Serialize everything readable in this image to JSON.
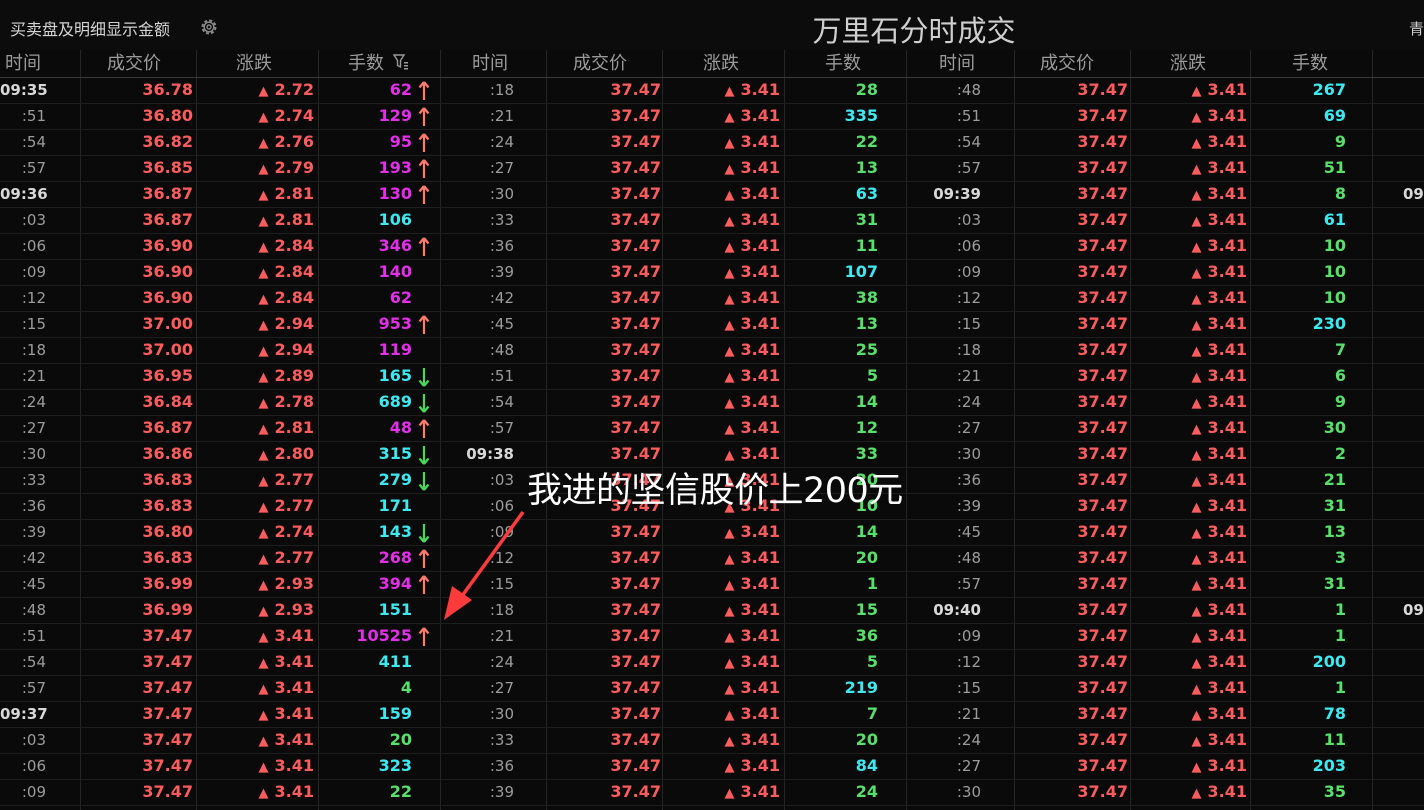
{
  "toolbar": {
    "option_label": "买卖盘及明细显示金额",
    "title": "万里石分时成交",
    "edge_char": "青"
  },
  "headers": [
    "时间",
    "成交价",
    "涨跌",
    "手数"
  ],
  "colors": {
    "up": "#ff5d5d",
    "big_buy": "#e22fe8",
    "neutral": "#3ee8f0",
    "small": "#59e06b",
    "up_arrow": "#ff7b6a",
    "down_arrow": "#47d95a"
  },
  "columns": [
    {
      "rows": [
        {
          "time": "09:35",
          "full": true,
          "price": "36.78",
          "chg": "2.72",
          "vol": "62",
          "vc": "big_buy",
          "arrow": "up"
        },
        {
          "time": ":51",
          "price": "36.80",
          "chg": "2.74",
          "vol": "129",
          "vc": "big_buy",
          "arrow": "up"
        },
        {
          "time": ":54",
          "price": "36.82",
          "chg": "2.76",
          "vol": "95",
          "vc": "big_buy",
          "arrow": "up"
        },
        {
          "time": ":57",
          "price": "36.85",
          "chg": "2.79",
          "vol": "193",
          "vc": "big_buy",
          "arrow": "up"
        },
        {
          "time": "09:36",
          "full": true,
          "price": "36.87",
          "chg": "2.81",
          "vol": "130",
          "vc": "big_buy",
          "arrow": "up"
        },
        {
          "time": ":03",
          "price": "36.87",
          "chg": "2.81",
          "vol": "106",
          "vc": "neutral",
          "arrow": ""
        },
        {
          "time": ":06",
          "price": "36.90",
          "chg": "2.84",
          "vol": "346",
          "vc": "big_buy",
          "arrow": "up"
        },
        {
          "time": ":09",
          "price": "36.90",
          "chg": "2.84",
          "vol": "140",
          "vc": "big_buy",
          "arrow": ""
        },
        {
          "time": ":12",
          "price": "36.90",
          "chg": "2.84",
          "vol": "62",
          "vc": "big_buy",
          "arrow": ""
        },
        {
          "time": ":15",
          "price": "37.00",
          "chg": "2.94",
          "vol": "953",
          "vc": "big_buy",
          "arrow": "up"
        },
        {
          "time": ":18",
          "price": "37.00",
          "chg": "2.94",
          "vol": "119",
          "vc": "big_buy",
          "arrow": ""
        },
        {
          "time": ":21",
          "price": "36.95",
          "chg": "2.89",
          "vol": "165",
          "vc": "neutral",
          "arrow": "down"
        },
        {
          "time": ":24",
          "price": "36.84",
          "chg": "2.78",
          "vol": "689",
          "vc": "neutral",
          "arrow": "down"
        },
        {
          "time": ":27",
          "price": "36.87",
          "chg": "2.81",
          "vol": "48",
          "vc": "big_buy",
          "arrow": "up"
        },
        {
          "time": ":30",
          "price": "36.86",
          "chg": "2.80",
          "vol": "315",
          "vc": "neutral",
          "arrow": "down"
        },
        {
          "time": ":33",
          "price": "36.83",
          "chg": "2.77",
          "vol": "279",
          "vc": "neutral",
          "arrow": "down"
        },
        {
          "time": ":36",
          "price": "36.83",
          "chg": "2.77",
          "vol": "171",
          "vc": "neutral",
          "arrow": ""
        },
        {
          "time": ":39",
          "price": "36.80",
          "chg": "2.74",
          "vol": "143",
          "vc": "neutral",
          "arrow": "down"
        },
        {
          "time": ":42",
          "price": "36.83",
          "chg": "2.77",
          "vol": "268",
          "vc": "big_buy",
          "arrow": "up"
        },
        {
          "time": ":45",
          "price": "36.99",
          "chg": "2.93",
          "vol": "394",
          "vc": "big_buy",
          "arrow": "up"
        },
        {
          "time": ":48",
          "price": "36.99",
          "chg": "2.93",
          "vol": "151",
          "vc": "neutral",
          "arrow": ""
        },
        {
          "time": ":51",
          "price": "37.47",
          "chg": "3.41",
          "vol": "10525",
          "vc": "big_buy",
          "arrow": "up"
        },
        {
          "time": ":54",
          "price": "37.47",
          "chg": "3.41",
          "vol": "411",
          "vc": "neutral",
          "arrow": ""
        },
        {
          "time": ":57",
          "price": "37.47",
          "chg": "3.41",
          "vol": "4",
          "vc": "small",
          "arrow": ""
        },
        {
          "time": "09:37",
          "full": true,
          "price": "37.47",
          "chg": "3.41",
          "vol": "159",
          "vc": "neutral",
          "arrow": ""
        },
        {
          "time": ":03",
          "price": "37.47",
          "chg": "3.41",
          "vol": "20",
          "vc": "small",
          "arrow": ""
        },
        {
          "time": ":06",
          "price": "37.47",
          "chg": "3.41",
          "vol": "323",
          "vc": "neutral",
          "arrow": ""
        },
        {
          "time": ":09",
          "price": "37.47",
          "chg": "3.41",
          "vol": "22",
          "vc": "small",
          "arrow": ""
        }
      ]
    },
    {
      "rows": [
        {
          "time": ":18",
          "price": "37.47",
          "chg": "3.41",
          "vol": "28",
          "vc": "small"
        },
        {
          "time": ":21",
          "price": "37.47",
          "chg": "3.41",
          "vol": "335",
          "vc": "neutral"
        },
        {
          "time": ":24",
          "price": "37.47",
          "chg": "3.41",
          "vol": "22",
          "vc": "small"
        },
        {
          "time": ":27",
          "price": "37.47",
          "chg": "3.41",
          "vol": "13",
          "vc": "small"
        },
        {
          "time": ":30",
          "price": "37.47",
          "chg": "3.41",
          "vol": "63",
          "vc": "neutral"
        },
        {
          "time": ":33",
          "price": "37.47",
          "chg": "3.41",
          "vol": "31",
          "vc": "small"
        },
        {
          "time": ":36",
          "price": "37.47",
          "chg": "3.41",
          "vol": "11",
          "vc": "small"
        },
        {
          "time": ":39",
          "price": "37.47",
          "chg": "3.41",
          "vol": "107",
          "vc": "neutral"
        },
        {
          "time": ":42",
          "price": "37.47",
          "chg": "3.41",
          "vol": "38",
          "vc": "small"
        },
        {
          "time": ":45",
          "price": "37.47",
          "chg": "3.41",
          "vol": "13",
          "vc": "small"
        },
        {
          "time": ":48",
          "price": "37.47",
          "chg": "3.41",
          "vol": "25",
          "vc": "small"
        },
        {
          "time": ":51",
          "price": "37.47",
          "chg": "3.41",
          "vol": "5",
          "vc": "small"
        },
        {
          "time": ":54",
          "price": "37.47",
          "chg": "3.41",
          "vol": "14",
          "vc": "small"
        },
        {
          "time": ":57",
          "price": "37.47",
          "chg": "3.41",
          "vol": "12",
          "vc": "small"
        },
        {
          "time": "09:38",
          "full": true,
          "price": "37.47",
          "chg": "3.41",
          "vol": "33",
          "vc": "small"
        },
        {
          "time": ":03",
          "price": "37.47",
          "chg": "3.41",
          "vol": "20",
          "vc": "small"
        },
        {
          "time": ":06",
          "price": "37.47",
          "chg": "3.41",
          "vol": "10",
          "vc": "small"
        },
        {
          "time": ":09",
          "price": "37.47",
          "chg": "3.41",
          "vol": "14",
          "vc": "small"
        },
        {
          "time": ":12",
          "price": "37.47",
          "chg": "3.41",
          "vol": "20",
          "vc": "small"
        },
        {
          "time": ":15",
          "price": "37.47",
          "chg": "3.41",
          "vol": "1",
          "vc": "small"
        },
        {
          "time": ":18",
          "price": "37.47",
          "chg": "3.41",
          "vol": "15",
          "vc": "small"
        },
        {
          "time": ":21",
          "price": "37.47",
          "chg": "3.41",
          "vol": "36",
          "vc": "small"
        },
        {
          "time": ":24",
          "price": "37.47",
          "chg": "3.41",
          "vol": "5",
          "vc": "small"
        },
        {
          "time": ":27",
          "price": "37.47",
          "chg": "3.41",
          "vol": "219",
          "vc": "neutral"
        },
        {
          "time": ":30",
          "price": "37.47",
          "chg": "3.41",
          "vol": "7",
          "vc": "small"
        },
        {
          "time": ":33",
          "price": "37.47",
          "chg": "3.41",
          "vol": "20",
          "vc": "small"
        },
        {
          "time": ":36",
          "price": "37.47",
          "chg": "3.41",
          "vol": "84",
          "vc": "neutral"
        },
        {
          "time": ":39",
          "price": "37.47",
          "chg": "3.41",
          "vol": "24",
          "vc": "small"
        }
      ]
    },
    {
      "rows": [
        {
          "time": ":48",
          "price": "37.47",
          "chg": "3.41",
          "vol": "267",
          "vc": "neutral"
        },
        {
          "time": ":51",
          "price": "37.47",
          "chg": "3.41",
          "vol": "69",
          "vc": "neutral"
        },
        {
          "time": ":54",
          "price": "37.47",
          "chg": "3.41",
          "vol": "9",
          "vc": "small"
        },
        {
          "time": ":57",
          "price": "37.47",
          "chg": "3.41",
          "vol": "51",
          "vc": "small"
        },
        {
          "time": "09:39",
          "full": true,
          "price": "37.47",
          "chg": "3.41",
          "vol": "8",
          "vc": "small"
        },
        {
          "time": ":03",
          "price": "37.47",
          "chg": "3.41",
          "vol": "61",
          "vc": "neutral"
        },
        {
          "time": ":06",
          "price": "37.47",
          "chg": "3.41",
          "vol": "10",
          "vc": "small"
        },
        {
          "time": ":09",
          "price": "37.47",
          "chg": "3.41",
          "vol": "10",
          "vc": "small"
        },
        {
          "time": ":12",
          "price": "37.47",
          "chg": "3.41",
          "vol": "10",
          "vc": "small"
        },
        {
          "time": ":15",
          "price": "37.47",
          "chg": "3.41",
          "vol": "230",
          "vc": "neutral"
        },
        {
          "time": ":18",
          "price": "37.47",
          "chg": "3.41",
          "vol": "7",
          "vc": "small"
        },
        {
          "time": ":21",
          "price": "37.47",
          "chg": "3.41",
          "vol": "6",
          "vc": "small"
        },
        {
          "time": ":24",
          "price": "37.47",
          "chg": "3.41",
          "vol": "9",
          "vc": "small"
        },
        {
          "time": ":27",
          "price": "37.47",
          "chg": "3.41",
          "vol": "30",
          "vc": "small"
        },
        {
          "time": ":30",
          "price": "37.47",
          "chg": "3.41",
          "vol": "2",
          "vc": "small"
        },
        {
          "time": ":36",
          "price": "37.47",
          "chg": "3.41",
          "vol": "21",
          "vc": "small"
        },
        {
          "time": ":39",
          "price": "37.47",
          "chg": "3.41",
          "vol": "31",
          "vc": "small"
        },
        {
          "time": ":45",
          "price": "37.47",
          "chg": "3.41",
          "vol": "13",
          "vc": "small"
        },
        {
          "time": ":48",
          "price": "37.47",
          "chg": "3.41",
          "vol": "3",
          "vc": "small"
        },
        {
          "time": ":57",
          "price": "37.47",
          "chg": "3.41",
          "vol": "31",
          "vc": "small"
        },
        {
          "time": "09:40",
          "full": true,
          "price": "37.47",
          "chg": "3.41",
          "vol": "1",
          "vc": "small"
        },
        {
          "time": ":09",
          "price": "37.47",
          "chg": "3.41",
          "vol": "1",
          "vc": "small"
        },
        {
          "time": ":12",
          "price": "37.47",
          "chg": "3.41",
          "vol": "200",
          "vc": "neutral"
        },
        {
          "time": ":15",
          "price": "37.47",
          "chg": "3.41",
          "vol": "1",
          "vc": "small"
        },
        {
          "time": ":21",
          "price": "37.47",
          "chg": "3.41",
          "vol": "78",
          "vc": "neutral"
        },
        {
          "time": ":24",
          "price": "37.47",
          "chg": "3.41",
          "vol": "11",
          "vc": "small"
        },
        {
          "time": ":27",
          "price": "37.47",
          "chg": "3.41",
          "vol": "203",
          "vc": "neutral"
        },
        {
          "time": ":30",
          "price": "37.47",
          "chg": "3.41",
          "vol": "35",
          "vc": "small"
        }
      ]
    }
  ],
  "edge_partial": [
    {
      "row": 4,
      "text": "09"
    },
    {
      "row": 20,
      "text": "09"
    }
  ],
  "annotation": {
    "text": "我进的坚信股价上200元"
  }
}
